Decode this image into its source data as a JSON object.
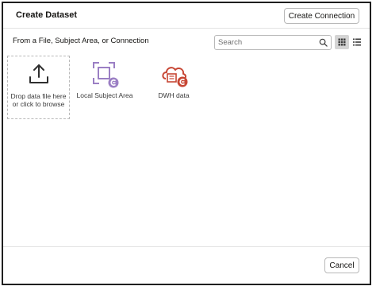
{
  "dialog": {
    "title": "Create Dataset",
    "create_connection_label": "Create Connection",
    "cancel_label": "Cancel"
  },
  "toolbar": {
    "source_label": "From a File, Subject Area, or Connection",
    "search_placeholder": "Search",
    "search_value": "",
    "active_view": "grid"
  },
  "sources": [
    {
      "label": "Drop data file here or click to browse",
      "icon": "upload-icon"
    },
    {
      "label": "Local Subject Area",
      "icon": "local-subject-area-icon"
    },
    {
      "label": "DWH data",
      "icon": "dwh-connection-icon"
    }
  ],
  "colors": {
    "subject_area_purple": "#9b7fc4",
    "dwh_red": "#c74634",
    "text": "#161513",
    "border": "#b8b8b8"
  }
}
